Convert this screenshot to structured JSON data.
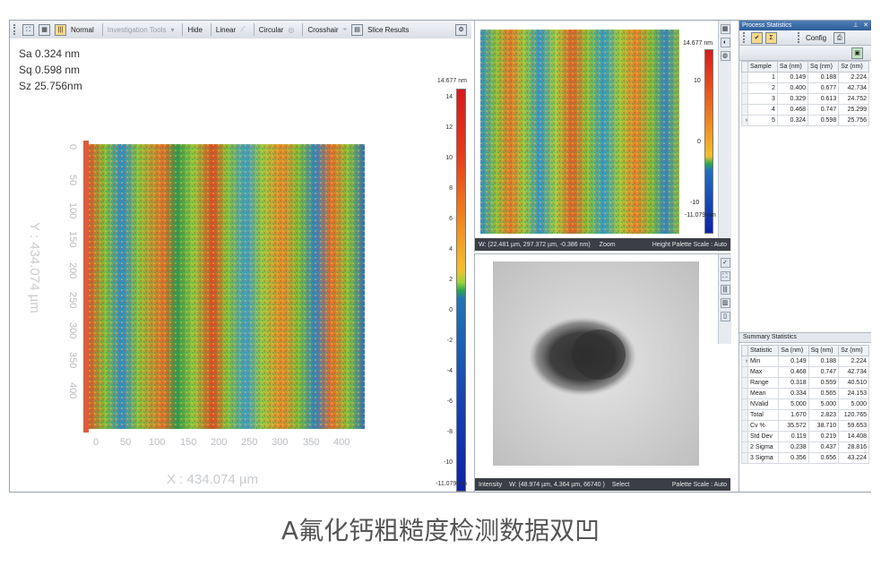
{
  "toolbar": {
    "mode_label": "Normal",
    "investigation_label": "Investigation Tools",
    "hide_label": "Hide",
    "linear_label": "Linear",
    "circular_label": "Circular",
    "crosshair_label": "Crosshair",
    "slice_label": "Slice Results"
  },
  "overlay": {
    "sa": "Sa 0.324  nm",
    "sq": "Sq 0.598  nm",
    "sz": "Sz 25.756nm"
  },
  "view3d": {
    "x_axis_label": "X : 434.074 µm",
    "y_axis_label": "Y : 434.074 µm",
    "x_ticks": [
      "0",
      "50",
      "100",
      "150",
      "200",
      "250",
      "300",
      "350",
      "400"
    ],
    "y_ticks": [
      "0",
      "50",
      "100",
      "150",
      "200",
      "250",
      "300",
      "350",
      "400"
    ],
    "scale_max": "14.677 nm",
    "scale_min": "-11.079 nm",
    "scale_ticks": [
      "14",
      "12",
      "10",
      "8",
      "6",
      "4",
      "2",
      "0",
      "-2",
      "-4",
      "-6",
      "-8",
      "-10"
    ]
  },
  "map2d": {
    "scale_max": "14.677 nm",
    "scale_min": "-11.079 nm",
    "scale_ticks": [
      "10",
      "0",
      "-10"
    ],
    "status_coords": "W: (22.481 µm, 297.372 µm, -0.386 nm)",
    "status_zoom": "Zoom",
    "status_palette": "Height Palette Scale : Auto"
  },
  "intensity": {
    "status_mode": "Intensity",
    "status_coords": "W: (48.974 µm, 4.364 µm, 66740 )",
    "status_select": "Select",
    "status_palette": "Palette Scale : Auto"
  },
  "process_stats": {
    "title": "Process Statistics",
    "config_label": "Config",
    "headers": [
      "Sample",
      "Sa (nm)",
      "Sq (nm)",
      "Sz (nm)"
    ],
    "rows": [
      [
        "1",
        "0.149",
        "0.188",
        "2.224"
      ],
      [
        "2",
        "0.400",
        "0.677",
        "42.734"
      ],
      [
        "3",
        "0.329",
        "0.613",
        "24.752"
      ],
      [
        "4",
        "0.468",
        "0.747",
        "25.299"
      ],
      [
        "5",
        "0.324",
        "0.598",
        "25.756"
      ]
    ]
  },
  "summary_stats": {
    "title": "Summary Statistics",
    "headers": [
      "Statistic",
      "Sa (nm)",
      "Sq (nm)",
      "Sz (nm)"
    ],
    "rows": [
      [
        "Min",
        "0.149",
        "0.188",
        "2.224"
      ],
      [
        "Max",
        "0.468",
        "0.747",
        "42.734"
      ],
      [
        "Range",
        "0.318",
        "0.559",
        "40.510"
      ],
      [
        "Mean",
        "0.334",
        "0.565",
        "24.153"
      ],
      [
        "NValid",
        "5.000",
        "5.000",
        "5.000"
      ],
      [
        "Total",
        "1.670",
        "2.823",
        "120.765"
      ],
      [
        "Cv %",
        "35.572",
        "38.710",
        "59.653"
      ],
      [
        "Std Dev",
        "0.119",
        "0.219",
        "14.408"
      ],
      [
        "2 Sigma",
        "0.238",
        "0.437",
        "28.816"
      ],
      [
        "3 Sigma",
        "0.356",
        "0.656",
        "43.224"
      ]
    ]
  },
  "caption": "A氟化钙粗糙度检测数据双凹"
}
